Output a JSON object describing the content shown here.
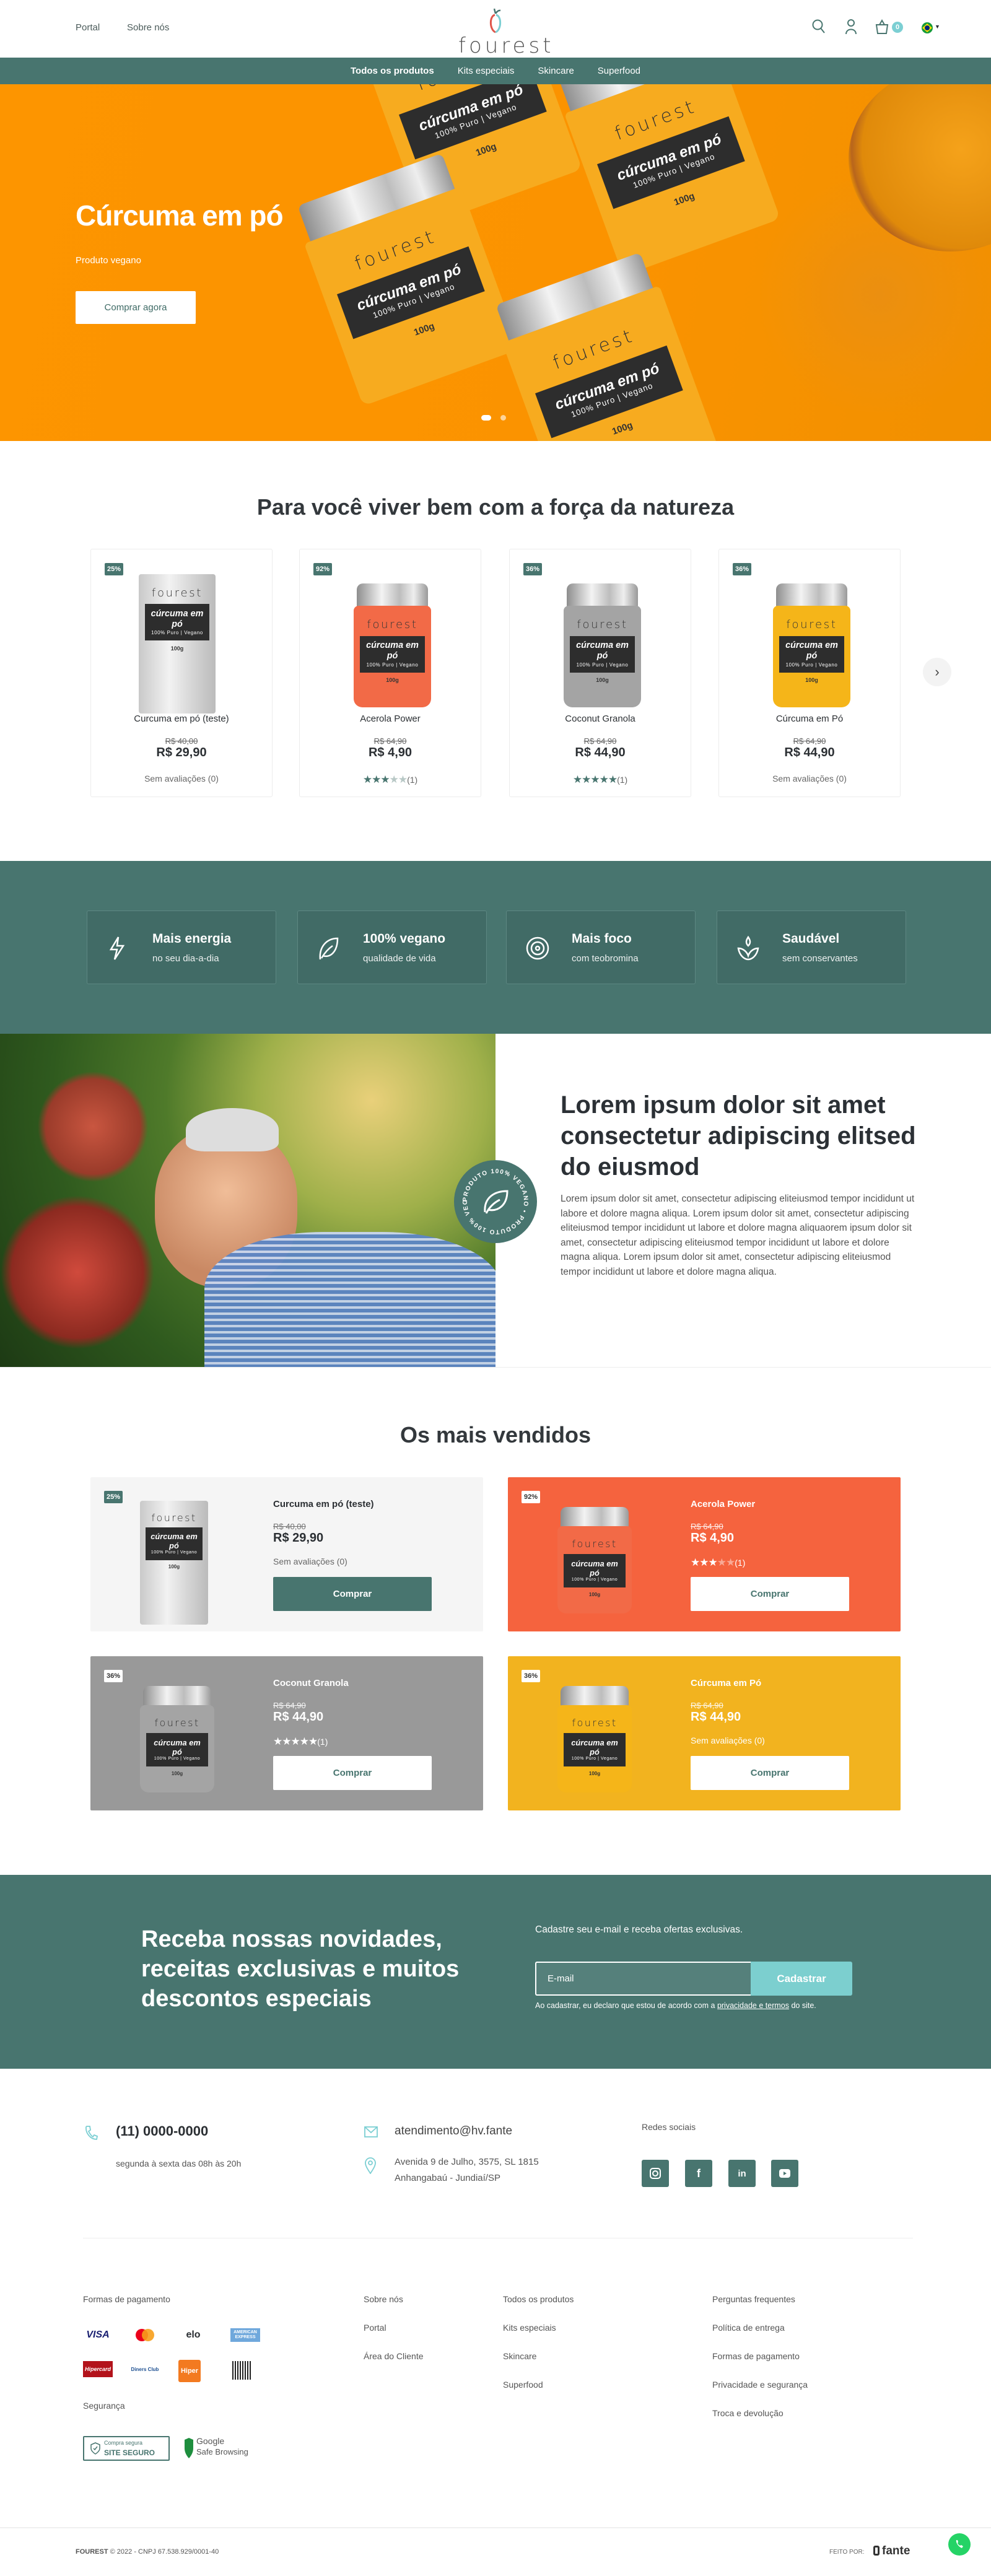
{
  "header": {
    "nav_left": [
      {
        "label": "Portal"
      },
      {
        "label": "Sobre nós"
      }
    ],
    "logo": "fourest",
    "icons": [
      "search-icon",
      "user-icon",
      "cart-icon",
      "brazil-flag-icon"
    ],
    "cart_count": "0"
  },
  "categories": [
    {
      "label": "Todos os produtos"
    },
    {
      "label": "Kits especiais"
    },
    {
      "label": "Skincare"
    },
    {
      "label": "Superfood"
    }
  ],
  "hero": {
    "title": "Cúrcuma em pó",
    "subtitle": "Produto vegano",
    "button": "Comprar agora",
    "slides": 2,
    "active_slide": 1,
    "background_color": "#fd9500"
  },
  "packaging": {
    "brand": "fourest",
    "label": "cúrcuma em pó",
    "sub": "100% Puro | Vegano",
    "weight": "100g"
  },
  "featured": {
    "title": "Para você viver bem com a força da natureza",
    "products": [
      {
        "badge": "25%",
        "name": "Curcuma em pó (teste)",
        "old_price": "R$ 40,00",
        "price": "R$ 29,90",
        "rating": 0,
        "reviews": "Sem avaliações (0)",
        "type": "pouch",
        "color": "#d9d9d9"
      },
      {
        "badge": "92%",
        "name": "Acerola Power",
        "old_price": "R$ 64,90",
        "price": "R$ 4,90",
        "rating": 3,
        "reviews": "(1)",
        "type": "jar",
        "color": "#f26a47"
      },
      {
        "badge": "36%",
        "name": "Coconut Granola",
        "old_price": "R$ 64,90",
        "price": "R$ 44,90",
        "rating": 5,
        "reviews": "(1)",
        "type": "jar",
        "color": "#a4a4a4"
      },
      {
        "badge": "36%",
        "name": "Cúrcuma em Pó",
        "old_price": "R$ 64,90",
        "price": "R$ 44,90",
        "rating": 0,
        "reviews": "Sem avaliações (0)",
        "type": "jar",
        "color": "#f5b519"
      }
    ]
  },
  "benefits": [
    {
      "title": "Mais energia",
      "subtitle": "no seu dia-a-dia",
      "icon": "lightning-icon"
    },
    {
      "title": "100% vegano",
      "subtitle": "qualidade de vida",
      "icon": "leaf-icon"
    },
    {
      "title": "Mais foco",
      "subtitle": "com teobromina",
      "icon": "target-icon"
    },
    {
      "title": "Saudável",
      "subtitle": "sem conservantes",
      "icon": "sprout-icon"
    }
  ],
  "about": {
    "heading": "Lorem ipsum dolor sit amet consectetur adipiscing elitsed do eiusmod",
    "paragraph": "Lorem ipsum dolor sit amet, consectetur adipiscing eliteiusmod tempor incididunt ut labore et dolore magna aliqua. Lorem ipsum dolor sit amet, consectetur adipiscing eliteiusmod tempor incididunt ut labore et dolore magna aliquaorem ipsum dolor sit amet, consectetur adipiscing eliteiusmod tempor incididunt ut labore et dolore magna aliqua. Lorem ipsum dolor sit amet, consectetur adipiscing eliteiusmod tempor incididunt ut labore et dolore magna aliqua.",
    "badge_text": "PRODUTO 100% VEGANO • PRODUTO 100% VEGANO •"
  },
  "bestsellers": {
    "title": "Os mais vendidos",
    "buy_label": "Comprar",
    "card_colors": [
      "#f5f5f5",
      "#f5633e",
      "#999999",
      "#f2b31f"
    ]
  },
  "newsletter": {
    "heading": "Receba nossas novidades, receitas exclusivas e muitos descontos especiais",
    "intro": "Cadastre seu e-mail e receba ofertas exclusivas.",
    "placeholder": "E-mail",
    "button": "Cadastrar",
    "disclaimer_pre": "Ao cadastrar, eu declaro que estou de acordo com a ",
    "disclaimer_link": "privacidade e termos",
    "disclaimer_post": " do site.",
    "button_color": "#7ccfcf"
  },
  "contact": {
    "phone": "(11) 0000-0000",
    "hours": "segunda à sexta das 08h às 20h",
    "email": "atendimento@hv.fante",
    "address_1": "Avenida 9 de Julho, 3575, SL 1815",
    "address_2": "Anhangabaú - Jundiaí/SP",
    "social_title": "Redes sociais",
    "socials": [
      "instagram-icon",
      "facebook-icon",
      "linkedin-icon",
      "youtube-icon"
    ]
  },
  "footer": {
    "payment_title": "Formas de pagamento",
    "payments": [
      "VISA",
      "Mastercard",
      "elo",
      "American Express",
      "Hipercard",
      "Diners Club",
      "Hiper",
      "Boleto"
    ],
    "security_title": "Segurança",
    "seal_1_top": "Compra segura",
    "seal_1_bottom": "SITE SEGURO",
    "seal_2_top": "Google",
    "seal_2_bottom": "Safe Browsing",
    "col1": [
      {
        "label": "Sobre nós"
      },
      {
        "label": "Portal"
      },
      {
        "label": "Área do Cliente"
      }
    ],
    "col2": [
      {
        "label": "Todos os produtos"
      },
      {
        "label": "Kits especiais"
      },
      {
        "label": "Skincare"
      },
      {
        "label": "Superfood"
      }
    ],
    "col3": [
      {
        "label": "Perguntas frequentes"
      },
      {
        "label": "Política de entrega"
      },
      {
        "label": "Formas de pagamento"
      },
      {
        "label": "Privacidade e segurança"
      },
      {
        "label": "Troca e devolução"
      }
    ],
    "brand": "FOUREST",
    "copyright": "© 2022 - CNPJ 67.538.929/0001-40",
    "made_by": "FEITO POR:",
    "made_by_brand": "fante"
  },
  "colors": {
    "primary": "#48756f",
    "accent": "#7ccfd3",
    "whatsapp": "#25d366"
  }
}
